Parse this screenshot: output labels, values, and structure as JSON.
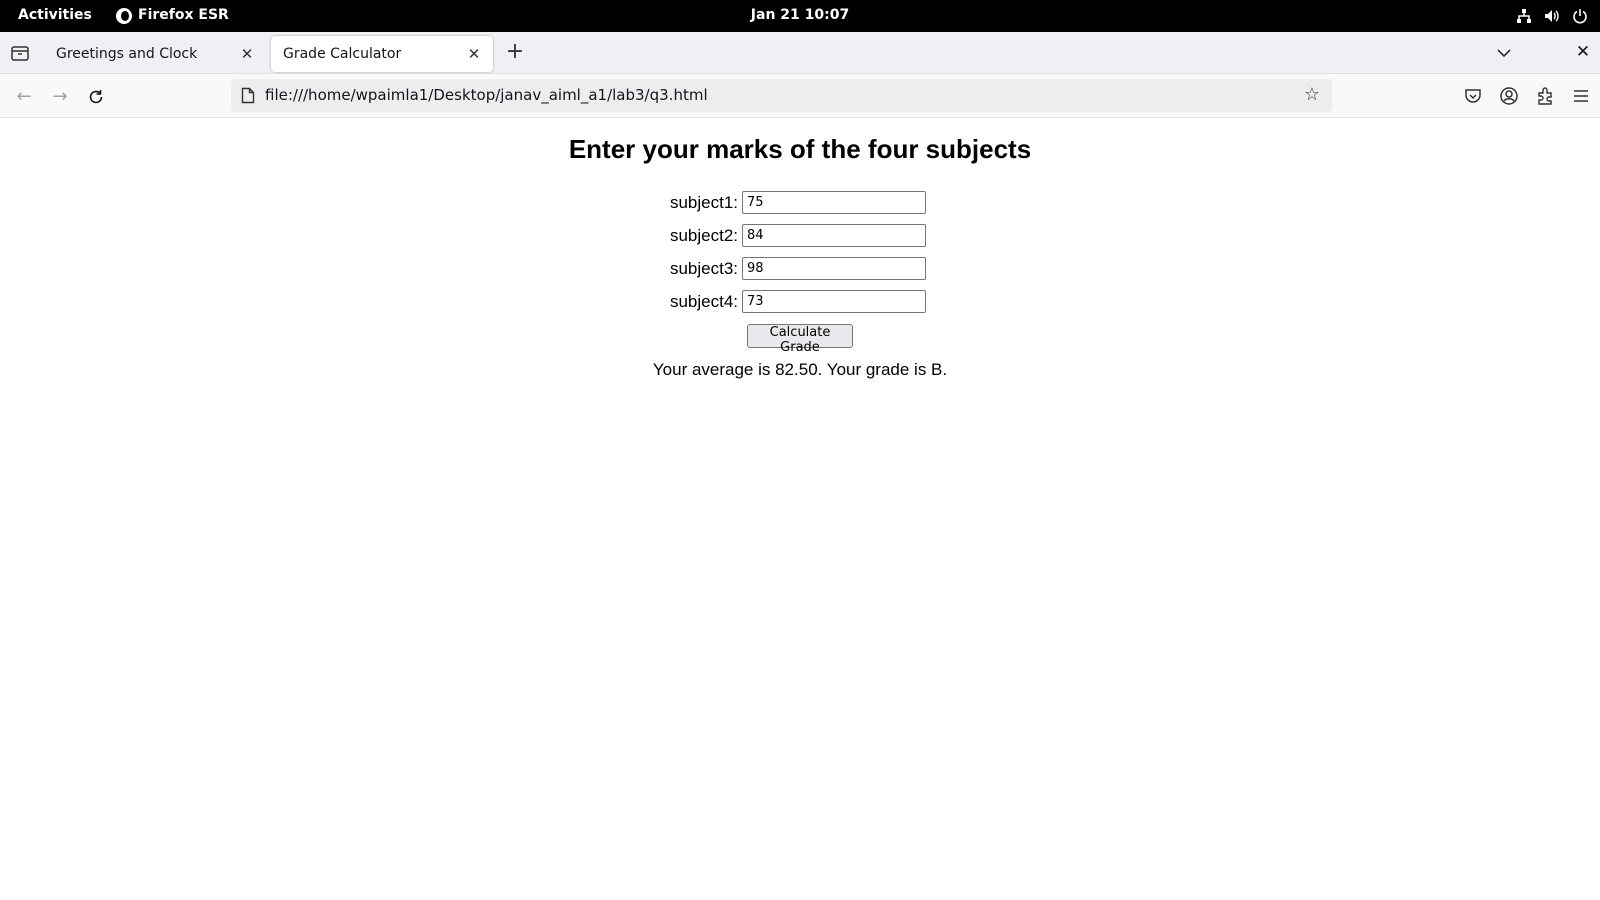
{
  "topbar": {
    "activities": "Activities",
    "app_name": "Firefox ESR",
    "clock": "Jan 21  10:07",
    "icons": [
      "network-icon",
      "volume-icon",
      "power-icon"
    ]
  },
  "tabs": [
    {
      "title": "Greetings and Clock",
      "active": false
    },
    {
      "title": "Grade Calculator",
      "active": true
    }
  ],
  "navbar": {
    "url": "file:///home/wpaimla1/Desktop/janav_aiml_a1/lab3/q3.html"
  },
  "page": {
    "heading": "Enter your marks of the four subjects",
    "fields": [
      {
        "label": "subject1:",
        "value": "75"
      },
      {
        "label": "subject2:",
        "value": "84"
      },
      {
        "label": "subject3:",
        "value": "98"
      },
      {
        "label": "subject4:",
        "value": "73"
      }
    ],
    "button_label": "Calculate Grade",
    "result": "Your average is 82.50. Your grade is B."
  },
  "colors": {
    "topbar_bg": "#000000",
    "tabstrip_bg": "#f0f0f4",
    "urlbar_bg": "#ededf0"
  }
}
